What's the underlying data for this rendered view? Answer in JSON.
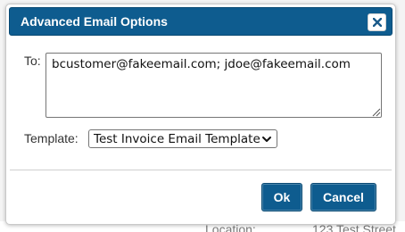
{
  "background": {
    "label": "Location:",
    "value": "123 Test Street"
  },
  "dialog": {
    "title": "Advanced Email Options",
    "close_icon": "close-icon",
    "to_label": "To:",
    "to_value": "bcustomer@fakeemail.com; jdoe@fakeemail.com",
    "template_label": "Template:",
    "template_selected": "Test Invoice Email Template",
    "ok_label": "Ok",
    "cancel_label": "Cancel"
  },
  "colors": {
    "accent": "#0e5c8f",
    "button_text": "#ffffff"
  }
}
